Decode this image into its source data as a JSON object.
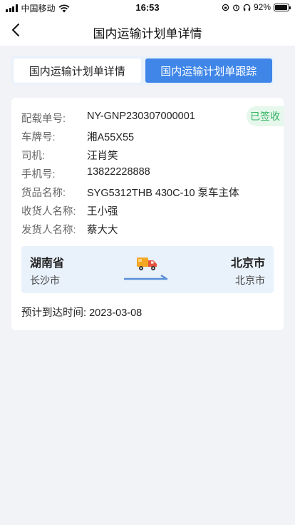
{
  "status_bar": {
    "carrier": "中国移动",
    "time": "16:53",
    "battery_text": "92%",
    "battery_level": 0.92
  },
  "nav": {
    "title": "国内运输计划单详情",
    "back_icon": "chevron-left-icon"
  },
  "tabs": [
    {
      "label": "国内运输计划单详情",
      "active": false
    },
    {
      "label": "国内运输计划单跟踪",
      "active": true
    }
  ],
  "detail": {
    "status": "已签收",
    "status_color": "#2fb35e",
    "fields": [
      {
        "label": "配载单号:",
        "value": "NY-GNP230307000001"
      },
      {
        "label": "车牌号:",
        "value": "湘A55X55"
      },
      {
        "label": "司机:",
        "value": "汪肖笑"
      },
      {
        "label": "手机号:",
        "value": "13822228888"
      },
      {
        "label": "货品名称:",
        "value": "SYG5312THB 430C-10 泵车主体"
      },
      {
        "label": "收货人名称:",
        "value": "王小强"
      },
      {
        "label": "发货人名称:",
        "value": "蔡大大"
      }
    ],
    "route": {
      "from_province": "湖南省",
      "from_city": "长沙市",
      "to_province": "北京市",
      "to_city": "北京市",
      "icon": "truck-icon"
    },
    "eta_label": "预计到达时间:",
    "eta_value": "2023-03-08"
  },
  "colors": {
    "accent": "#3f86e8",
    "route_bg": "#e9f1fb",
    "page_bg": "#f2f3f7"
  }
}
